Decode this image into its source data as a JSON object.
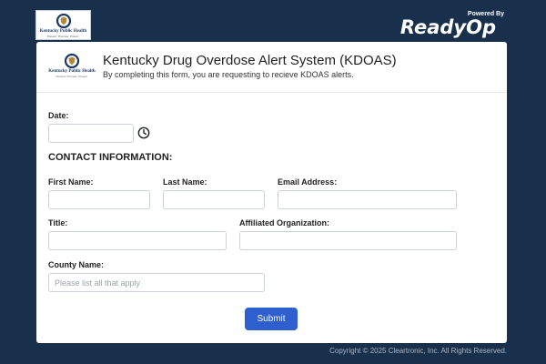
{
  "header_bar": {
    "logo": {
      "text": "Kentucky Public Health",
      "sub": "Prevent. Promote. Protect."
    },
    "powered_by": "Powered By",
    "brand": "ReadyOp"
  },
  "form_header": {
    "logo": {
      "text": "Kentucky Public Health",
      "sub": "Prevent. Promote. Protect."
    },
    "title": "Kentucky Drug Overdose Alert System (KDOAS)",
    "subtitle": "By completing this form, you are requesting to recieve KDOAS alerts."
  },
  "fields": {
    "date": {
      "label": "Date:",
      "value": "",
      "icon": "clock-icon"
    },
    "contact_section": "CONTACT INFORMATION:",
    "first_name": {
      "label": "First Name:",
      "value": ""
    },
    "last_name": {
      "label": "Last Name:",
      "value": ""
    },
    "email": {
      "label": "Email Address:",
      "value": ""
    },
    "title": {
      "label": "Title:",
      "value": ""
    },
    "organization": {
      "label": "Affiliated Organization:",
      "value": ""
    },
    "county": {
      "label": "County Name:",
      "value": "",
      "placeholder": "Please list all that apply"
    }
  },
  "submit_label": "Submit",
  "footer": {
    "copyright": "Copyright © 2025 Cleartronic, Inc. All Rights Reserved."
  },
  "colors": {
    "background": "#19304d",
    "accent": "#2f5fcf",
    "card": "#ffffff"
  }
}
